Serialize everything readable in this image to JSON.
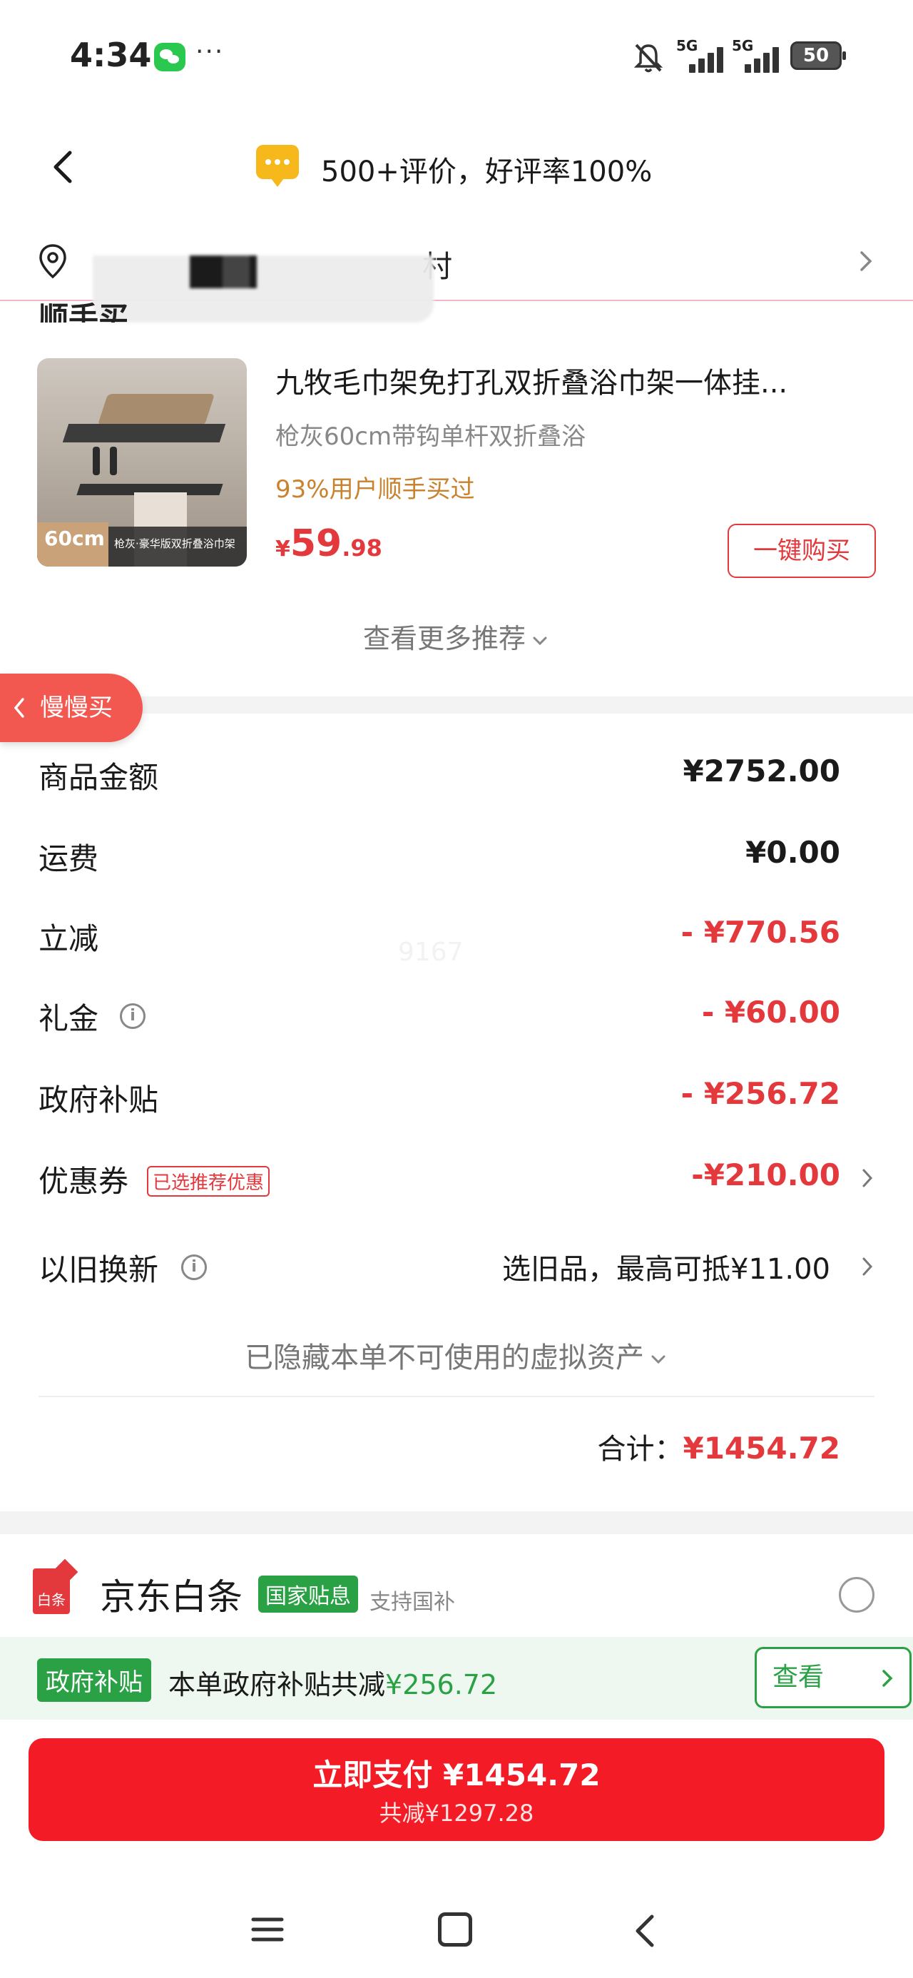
{
  "status_bar": {
    "time": "4:34",
    "more": "···",
    "network1": "5G",
    "network2": "5G",
    "battery": "50",
    "icons": [
      "wechat-icon",
      "mute-icon",
      "signal-icon",
      "battery-icon"
    ]
  },
  "header": {
    "title": "500+评价，好评率100%",
    "icons": [
      "back-icon",
      "message-icon"
    ]
  },
  "address": {
    "text_start": "",
    "text_end": "村"
  },
  "recommendation": {
    "section_label": "顺手买",
    "product": {
      "name": "九牧毛巾架免打孔双折叠浴巾架一体挂...",
      "spec": "枪灰60cm带钩单杆双折叠浴",
      "buyers": "93%用户顺手买过",
      "price_currency": "¥",
      "price_integer": "59",
      "price_decimal": ".98",
      "image_size_badge": "60cm",
      "image_caption": "枪灰·豪华版双折叠浴巾架",
      "buy_button": "一键购买"
    },
    "see_more": "查看更多推荐"
  },
  "slow_buy_tab": "慢慢买",
  "summary": {
    "goods_amount": {
      "label": "商品金额",
      "value": "¥2752.00"
    },
    "shipping": {
      "label": "运费",
      "value": "¥0.00"
    },
    "instant_discount": {
      "label": "立减",
      "value": "- ¥770.56"
    },
    "gift_money": {
      "label": "礼金",
      "value": "- ¥60.00"
    },
    "gov_subsidy": {
      "label": "政府补贴",
      "value": "- ¥256.72"
    },
    "coupon": {
      "label": "优惠券",
      "badge": "已选推荐优惠",
      "value": "-¥210.00"
    },
    "trade_in": {
      "label": "以旧换新",
      "value": "选旧品，最高可抵¥11.00"
    },
    "watermark": "9167",
    "hidden_assets": "已隐藏本单不可使用的虚拟资产",
    "total_label": "合计：",
    "total_value": "¥1454.72"
  },
  "payment": {
    "method_icon_text": "白条",
    "method_name": "京东白条",
    "gov_badge": "国家贴息",
    "support_text": "支持国补"
  },
  "subsidy_bar": {
    "tag": "政府补贴",
    "text": "本单政府补贴共减",
    "amount": "¥256.72",
    "view_button": "查看"
  },
  "pay_button": {
    "main": "立即支付 ¥1454.72",
    "sub": "共减¥1297.28"
  },
  "colors": {
    "accent_red": "#e4393c",
    "pay_red": "#f21b26",
    "subsidy_green": "#2aa144",
    "buyers_orange": "#c9822d"
  }
}
